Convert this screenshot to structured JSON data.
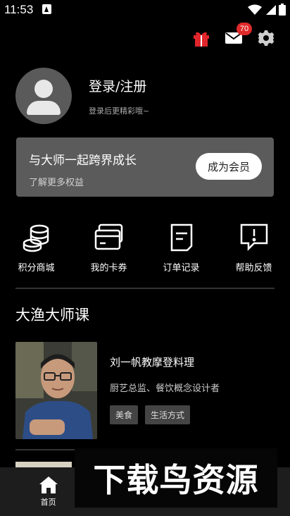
{
  "status_bar": {
    "time": "11:53"
  },
  "header": {
    "mail_badge": "70"
  },
  "profile": {
    "title": "登录/注册",
    "subtitle": "登录后更精彩哦~"
  },
  "member_card": {
    "title": "与大师一起跨界成长",
    "subtitle": "了解更多权益",
    "button_label": "成为会员"
  },
  "quick_actions": [
    {
      "label": "积分商城",
      "icon": "coins-icon"
    },
    {
      "label": "我的卡券",
      "icon": "cards-icon"
    },
    {
      "label": "订单记录",
      "icon": "order-icon"
    },
    {
      "label": "帮助反馈",
      "icon": "feedback-icon"
    }
  ],
  "section": {
    "title": "大渔大师课"
  },
  "course": {
    "title": "刘一帆教摩登料理",
    "description": "厨艺总监、餐饮概念设计者",
    "tags": [
      "美食",
      "生活方式"
    ]
  },
  "tabbar": {
    "items": [
      {
        "label": "首页"
      },
      {
        "label": ""
      },
      {
        "label": ""
      }
    ]
  },
  "watermark": {
    "text": "下载鸟资源"
  }
}
